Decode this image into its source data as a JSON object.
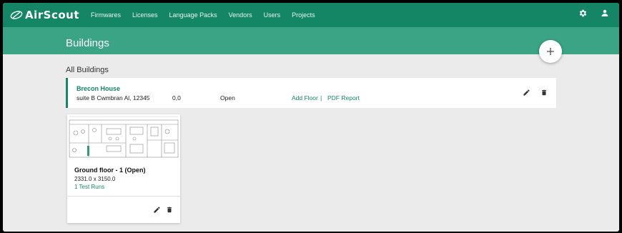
{
  "app": {
    "logo_text": "AirScout"
  },
  "nav": {
    "links": [
      "Firmwares",
      "Licenses",
      "Language Packs",
      "Vendors",
      "Users",
      "Projects"
    ]
  },
  "page": {
    "title": "Buildings",
    "section_title": "All Buildings"
  },
  "building": {
    "name": "Brecon House",
    "address": "suite B Cwmbran Al, 12345",
    "coords": "0,0",
    "status": "Open",
    "add_floor": "Add Floor",
    "separator": "|",
    "pdf_report": "PDF Report"
  },
  "floor_card": {
    "title": "Ground floor - 1 (Open)",
    "dimensions": "2331.0 x 3150.0",
    "test_runs": "1 Test Runs"
  },
  "icons": {
    "settings": "gear-icon",
    "user": "user-icon",
    "add": "plus-icon",
    "edit": "pencil-icon",
    "delete": "trash-icon"
  },
  "colors": {
    "primary": "#148665",
    "banner": "#3ba484",
    "background": "#ebebeb"
  }
}
